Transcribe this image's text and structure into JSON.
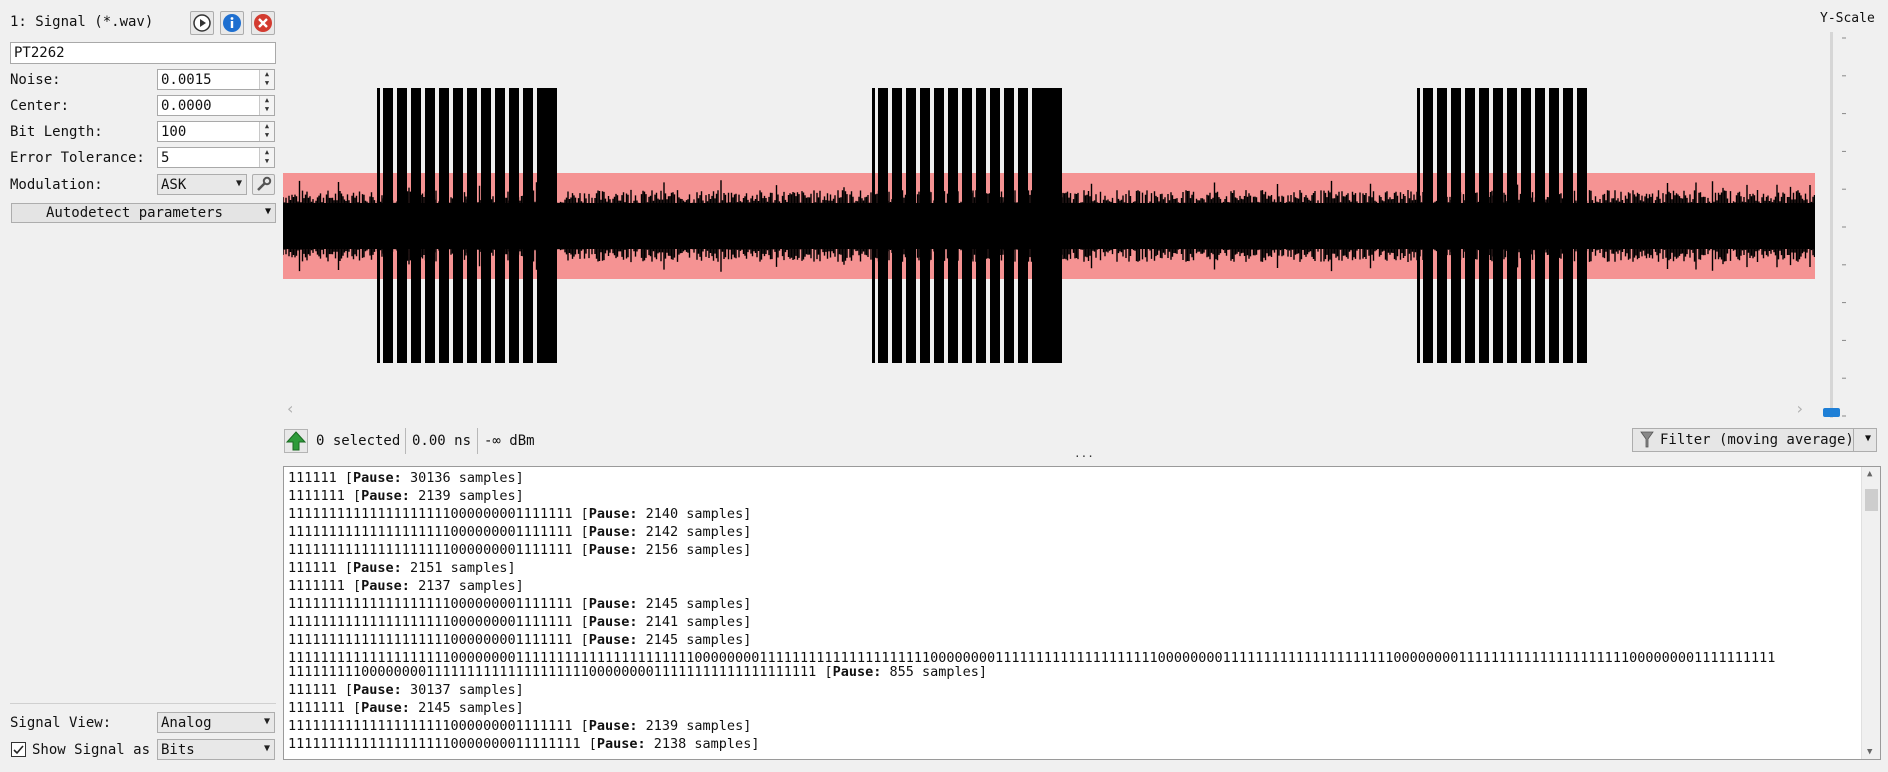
{
  "signal": {
    "title": "1: Signal (*.wav)",
    "name": "PT2262"
  },
  "params": {
    "noise_label": "Noise:",
    "noise_value": "0.0015",
    "center_label": "Center:",
    "center_value": "0.0000",
    "bitlength_label": "Bit Length:",
    "bitlength_value": "100",
    "tolerance_label": "Error Tolerance:",
    "tolerance_value": "5",
    "modulation_label": "Modulation:",
    "modulation_value": "ASK",
    "autodetect_label": "Autodetect parameters"
  },
  "bottom_left": {
    "signal_view_label": "Signal View:",
    "signal_view_value": "Analog",
    "show_signal_label": "Show Signal as",
    "show_signal_value": "Bits",
    "show_signal_checked": true
  },
  "yscale": {
    "label": "Y-Scale"
  },
  "status": {
    "selected": "0 selected",
    "time": "0.00 ns",
    "power": "-∞  dBm",
    "filter_label": "Filter (moving average)",
    "splitter_dots": "..."
  },
  "colors": {
    "noise_band": "#f59393",
    "signal": "#000000",
    "accent": "#1e7fd6",
    "close": "#d33b30"
  },
  "icons": {
    "play": "play-icon",
    "info": "info-icon",
    "close": "close-icon",
    "wrench": "wrench-icon",
    "funnel": "funnel-icon",
    "arrow": "up-arrow-icon"
  },
  "log": [
    {
      "bits": "111111 ",
      "pause": "30136"
    },
    {
      "bits": "1111111 ",
      "pause": "2139"
    },
    {
      "bits": "11111111111111111111000000001111111 ",
      "pause": "2140"
    },
    {
      "bits": "11111111111111111111000000001111111 ",
      "pause": "2142"
    },
    {
      "bits": "11111111111111111111000000001111111 ",
      "pause": "2156"
    },
    {
      "bits": "111111 ",
      "pause": "2151"
    },
    {
      "bits": "1111111 ",
      "pause": "2137"
    },
    {
      "bits": "11111111111111111111000000001111111 ",
      "pause": "2145"
    },
    {
      "bits": "11111111111111111111000000001111111 ",
      "pause": "2141"
    },
    {
      "bits": "11111111111111111111000000001111111 ",
      "pause": "2145"
    },
    {
      "bits": "111111111111111111110000000011111111111111111111110000000011111111111111111111100000000111111111111111111110000000011111111111111111111100000000111111111111111111111000000001111111111",
      "pause": null
    },
    {
      "bits": "11111111100000000111111111111111111110000000011111111111111111111 ",
      "pause": "855"
    },
    {
      "bits": "111111 ",
      "pause": "30137"
    },
    {
      "bits": "1111111 ",
      "pause": "2145"
    },
    {
      "bits": "11111111111111111111000000001111111 ",
      "pause": "2139"
    },
    {
      "bits": "111111111111111111110000000011111111 ",
      "pause": "2138"
    }
  ],
  "log_words": {
    "pause": "Pause:",
    "samples": "samples"
  }
}
